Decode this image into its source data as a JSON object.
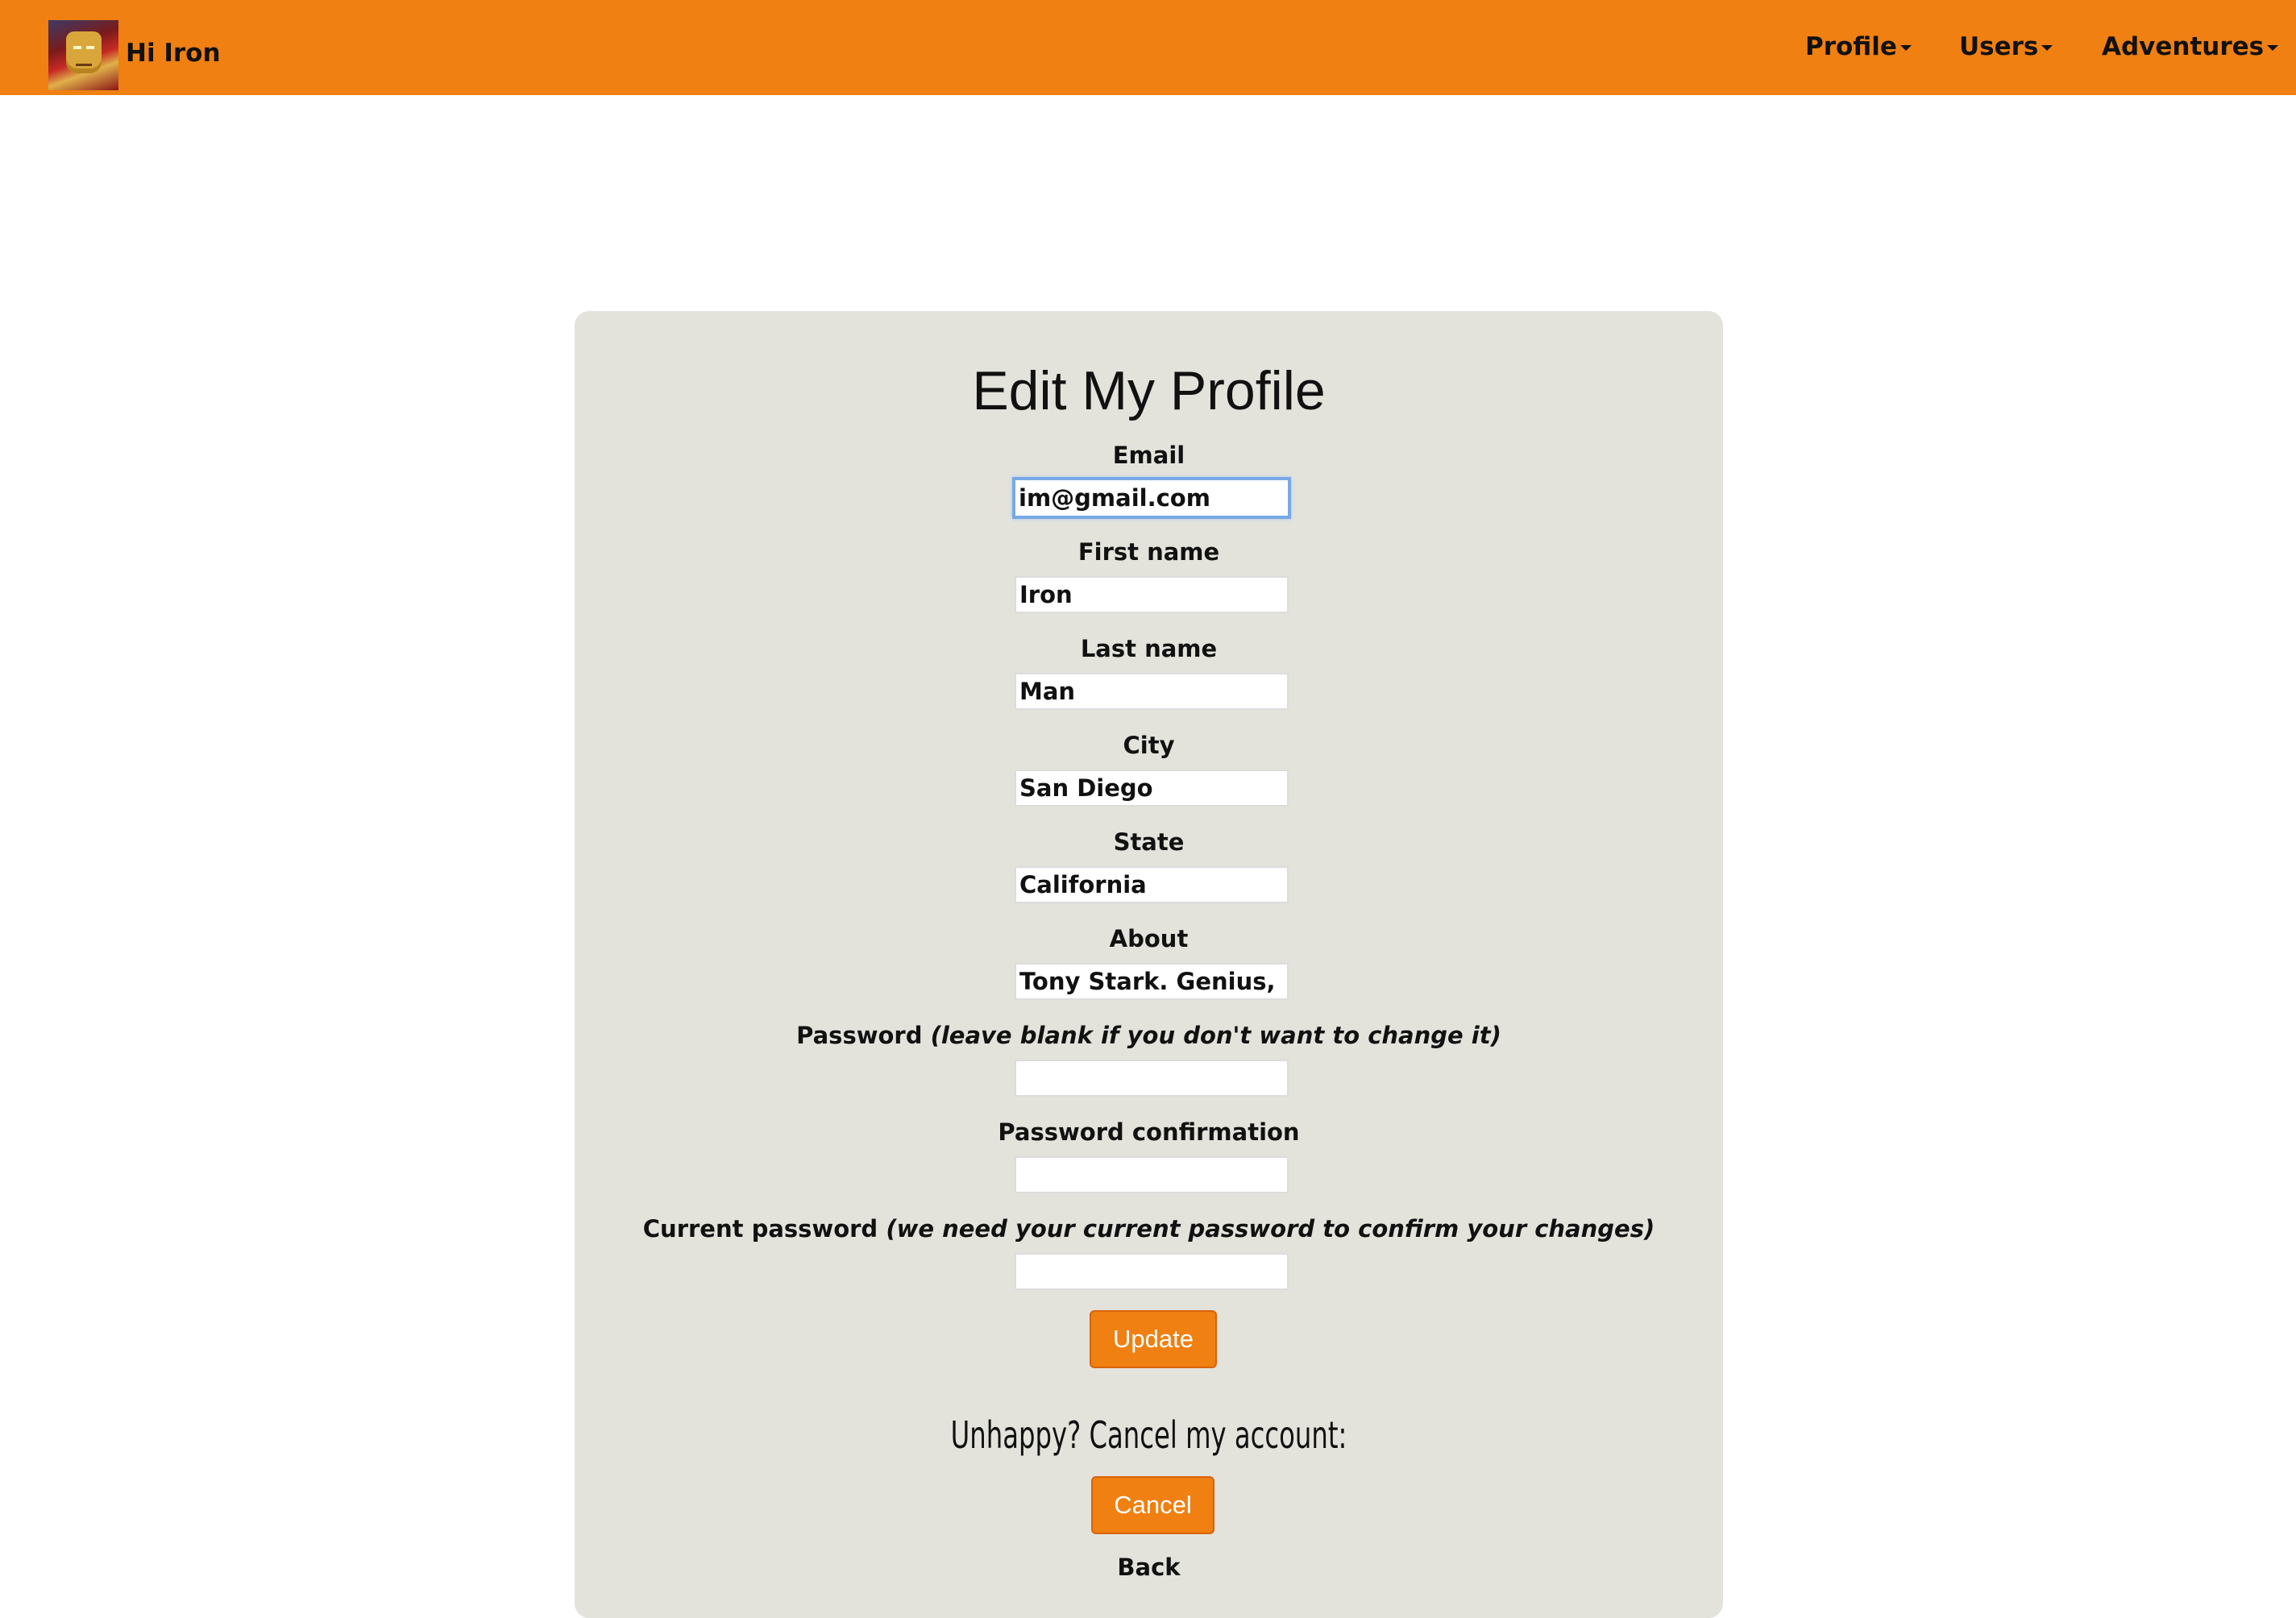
{
  "navbar": {
    "greeting": "Hi Iron",
    "menu": [
      {
        "label": "Profile"
      },
      {
        "label": "Users"
      },
      {
        "label": "Adventures"
      }
    ]
  },
  "form": {
    "title": "Edit My Profile",
    "fields": [
      {
        "label": "Email",
        "value": "im@gmail.com"
      },
      {
        "label": "First name",
        "value": "Iron"
      },
      {
        "label": "Last name",
        "value": "Man"
      },
      {
        "label": "City",
        "value": "San Diego"
      },
      {
        "label": "State",
        "value": "California"
      },
      {
        "label": "About",
        "value": "Tony Stark. Genius, billic"
      },
      {
        "label": "Password",
        "note": "(leave blank if you don't want to change it)",
        "value": ""
      },
      {
        "label": "Password confirmation",
        "value": ""
      },
      {
        "label": "Current password",
        "note": "(we need your current password to confirm your changes)",
        "value": ""
      }
    ],
    "update_label": "Update"
  },
  "cancel_section": {
    "heading": "Unhappy? Cancel my account:",
    "cancel_label": "Cancel"
  },
  "back_label": "Back",
  "colors": {
    "accent": "#ef8011",
    "panel": "#e3e3dc",
    "focus": "#79a8e6"
  }
}
